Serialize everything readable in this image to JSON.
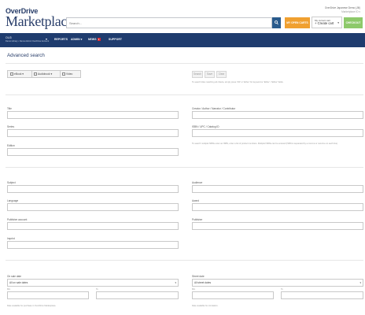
{
  "header": {
    "logo_top": "OverDrive",
    "logo_main": "Marketplace",
    "search_placeholder": "Search...",
    "account_name": "OverDrive Japanese Demo (Jill)",
    "account_sub": "Marketplace ID ▾",
    "cart_button": "MY OPEN CARTS",
    "cart_select_small": "My current cart",
    "cart_select_big": "+ Create cart",
    "checkout_button": "CHECKOUT"
  },
  "nav": {
    "library_name": "OLI3",
    "library_sub": "Demo Library • Demo Admin OverDrive Account",
    "items": [
      "REPORTS",
      "ADMIN ▾",
      "NEWS",
      "SUPPORT"
    ],
    "news_badge": "1"
  },
  "page": {
    "title": "Advanced search"
  },
  "toolbar": {
    "buttons": [
      "eBook ▾",
      "Audiobook ▾",
      "Video"
    ],
    "search_label": "Search",
    "save_label": "Save",
    "clear_label": "Clear",
    "hint": "To search titles matching all criteria, simply press 'OR' or 'Either' for keyword or 'Either' / 'Either' fields."
  },
  "fields": {
    "title": "Title",
    "creator": "Creator / Author / Narrator / Contributor",
    "series": "Series",
    "isbn": "ISBN / UPC / Catalog ID",
    "isbn_hint": "To search multiple ISBNs enter an ISBN, enter a list of product numbers. Multiple ISBNs can be entered (ISBN is separated by a comma or new line on each line).",
    "edition": "Edition",
    "subject": "Subject",
    "audience": "Audience",
    "language": "Language",
    "award": "Award",
    "publisher": "Publisher account",
    "publisher_name": "Publisher",
    "imprint": "Imprint",
    "on_sale_date": "On sale date",
    "on_sale_option": "All on sale dates",
    "on_sale_from": "Min",
    "on_sale_to": "To",
    "on_sale_hint": "Date available for purchase in OverDrive Marketplace.",
    "street_date": "Street date",
    "street_option": "All street dates",
    "street_from": "Min",
    "street_to": "To",
    "street_hint": "Date available for circulation."
  },
  "colors": {
    "brand_navy": "#1f3c6e",
    "cart_orange": "#f0a030",
    "checkout_green": "#8dc96a",
    "badge_red": "#d9262c"
  }
}
